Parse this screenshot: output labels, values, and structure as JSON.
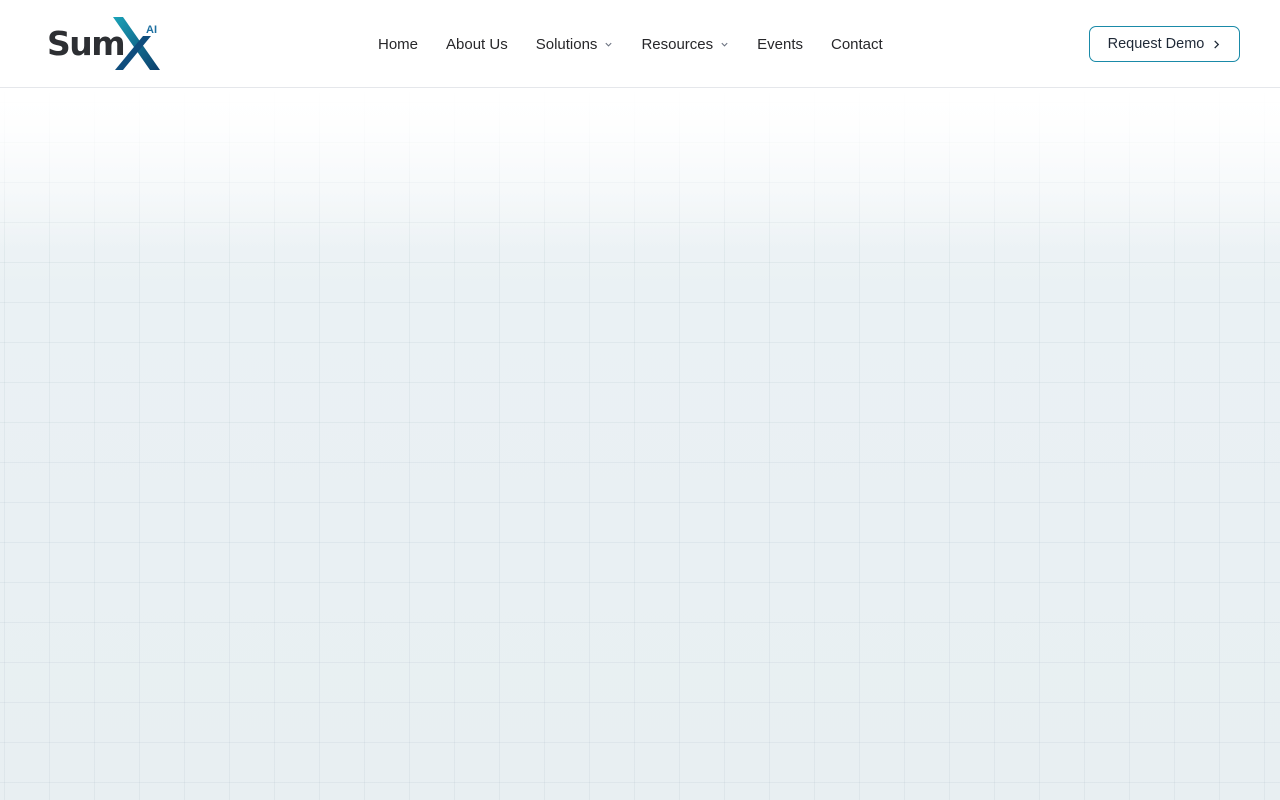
{
  "logo": {
    "text": "Sum",
    "superscript": "AI",
    "x_colors": [
      "#1aa3b8",
      "#0b3d6b"
    ]
  },
  "nav": {
    "items": [
      {
        "label": "Home",
        "has_dropdown": false
      },
      {
        "label": "About Us",
        "has_dropdown": false
      },
      {
        "label": "Solutions",
        "has_dropdown": true
      },
      {
        "label": "Resources",
        "has_dropdown": true
      },
      {
        "label": "Events",
        "has_dropdown": false
      },
      {
        "label": "Contact",
        "has_dropdown": false
      }
    ]
  },
  "cta": {
    "label": "Request Demo",
    "icon": "chevron-right-icon",
    "border_color": "#1a8aa8"
  },
  "colors": {
    "hero_background": "#e8eff2",
    "text": "#27272a"
  }
}
